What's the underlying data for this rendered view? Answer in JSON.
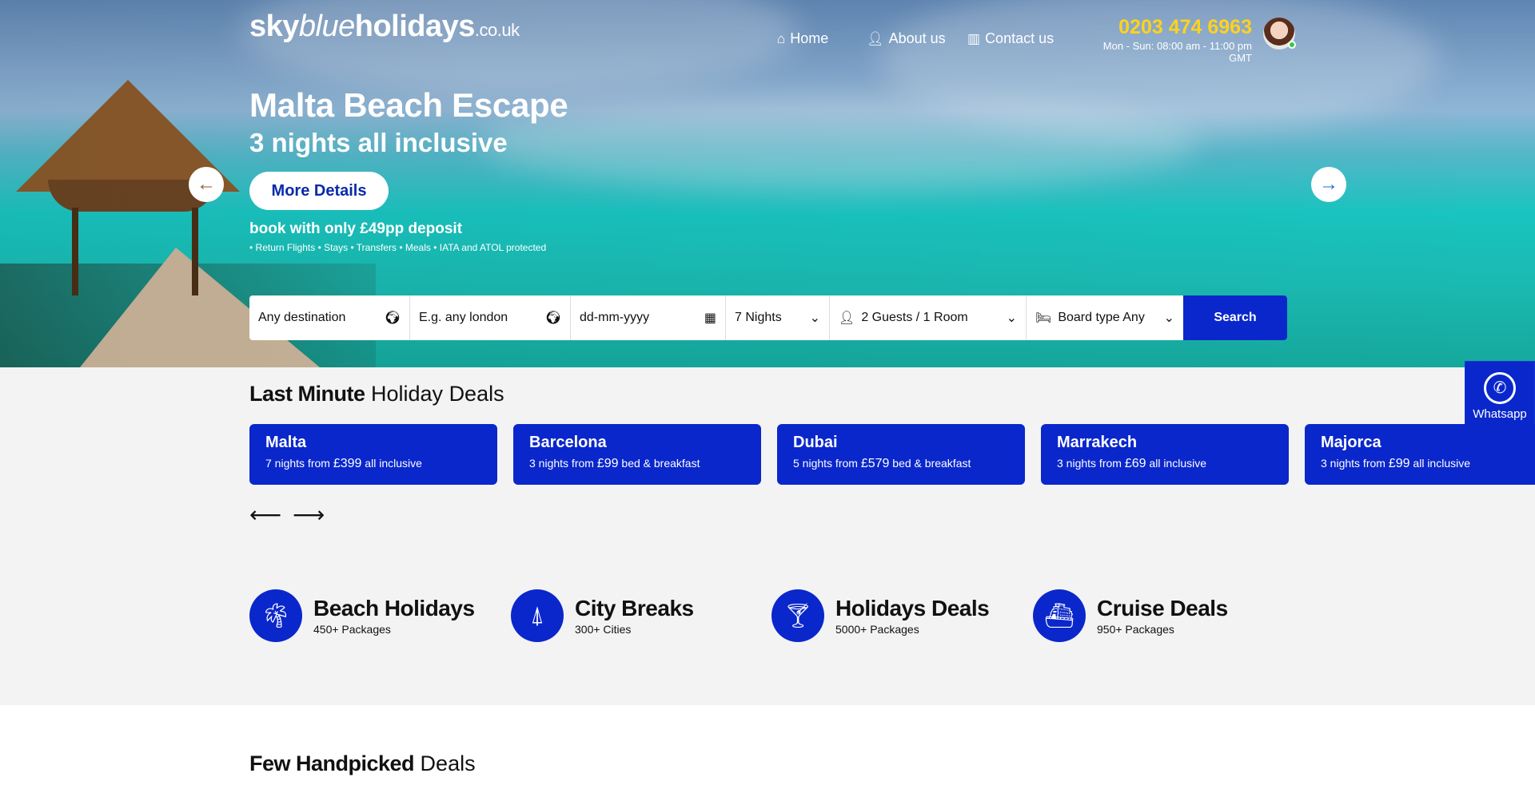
{
  "header": {
    "logo": {
      "part1": "sky",
      "part2": "blue",
      "part3": "holidays",
      "tld": ".co.uk"
    },
    "nav": [
      {
        "label": "Home",
        "icon": "home-icon"
      },
      {
        "label": "About us",
        "icon": "user-icon"
      },
      {
        "label": "Contact us",
        "icon": "map-icon"
      }
    ],
    "phone": "0203 474 6963",
    "hours": "Mon - Sun: 08:00 am - 11:00 pm GMT"
  },
  "hero": {
    "title": "Malta Beach Escape",
    "subtitle": "3 nights all inclusive",
    "button": "More Details",
    "deposit": "book with only £49pp deposit",
    "features": "• Return Flights • Stays • Transfers • Meals • IATA and ATOL protected"
  },
  "search": {
    "destination": "Any destination",
    "departure": "E.g. any london",
    "date": "dd-mm-yyyy",
    "nights": "7 Nights",
    "guests": "2 Guests / 1 Room",
    "board": "Board type Any",
    "button": "Search"
  },
  "whatsapp": {
    "label": "Whatsapp"
  },
  "last_minute": {
    "title_bold": "Last Minute",
    "title_rest": " Holiday Deals",
    "deals": [
      {
        "city": "Malta",
        "prefix": "7 nights from ",
        "price": "£399",
        "suffix": " all inclusive"
      },
      {
        "city": "Barcelona",
        "prefix": "3 nights from ",
        "price": "£99",
        "suffix": " bed & breakfast"
      },
      {
        "city": "Dubai",
        "prefix": "5 nights from ",
        "price": "£579",
        "suffix": " bed & breakfast"
      },
      {
        "city": "Marrakech",
        "prefix": "3 nights from ",
        "price": "£69",
        "suffix": " all inclusive"
      },
      {
        "city": "Majorca",
        "prefix": "3 nights from ",
        "price": "£99",
        "suffix": " all inclusive"
      }
    ]
  },
  "categories": [
    {
      "name": "Beach Holidays",
      "count": "450+ Packages",
      "icon": "palm-tree-icon"
    },
    {
      "name": "City Breaks",
      "count": "300+ Cities",
      "icon": "eiffel-tower-icon"
    },
    {
      "name": "Holidays Deals",
      "count": "5000+ Packages",
      "icon": "cocktail-icon"
    },
    {
      "name": "Cruise Deals",
      "count": "950+ Packages",
      "icon": "ship-icon"
    }
  ],
  "handpicked": {
    "title_bold": "Few Handpicked",
    "title_rest": " Deals"
  },
  "colors": {
    "brand_blue": "#0a27cc",
    "phone_yellow": "#ffd21e",
    "online_green": "#2ecc40"
  }
}
